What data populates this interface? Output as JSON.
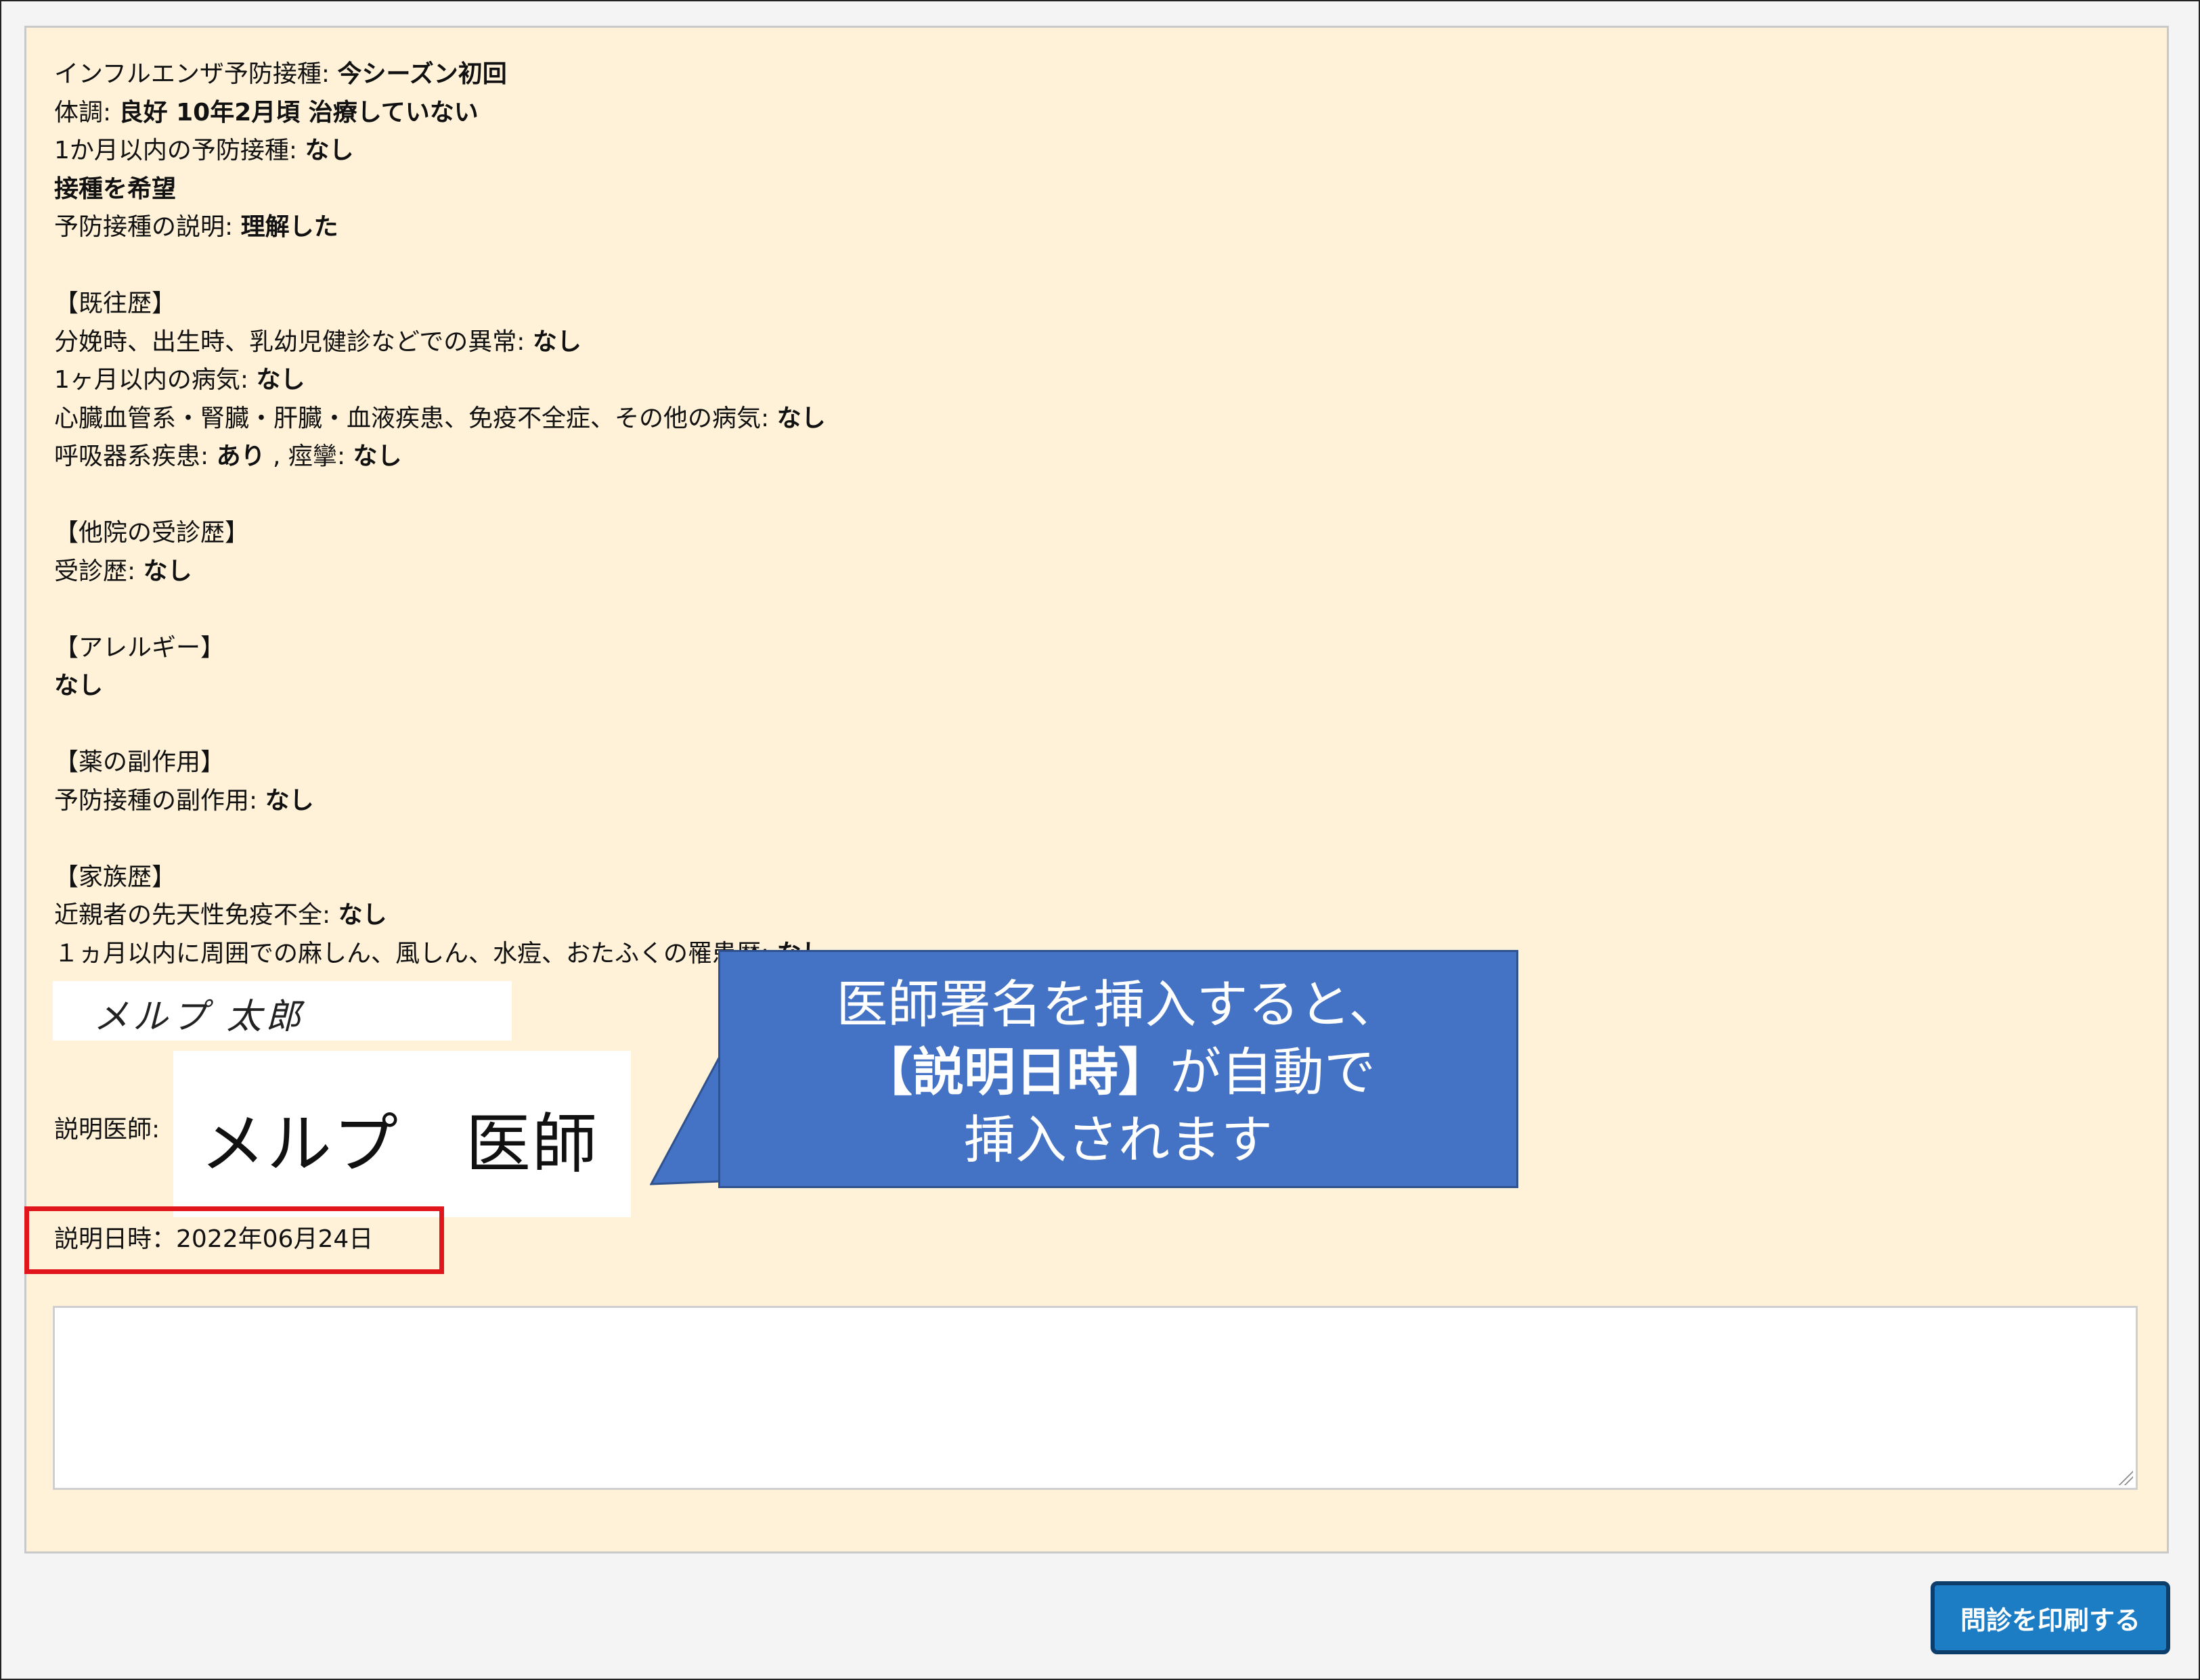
{
  "questionnaire": {
    "vaccine_label": "インフルエンザ予防接種: ",
    "vaccine_value": "今シーズン初回",
    "condition_label": "体調: ",
    "condition_value": "良好 10年2月頃 治療していない",
    "recent_vaccine_label": "1か月以内の予防接種: ",
    "recent_vaccine_value": "なし",
    "wish": "接種を希望",
    "explanation_label": "予防接種の説明: ",
    "explanation_value": "理解した",
    "history_heading": "【既往歴】",
    "birth_label": "分娩時、出生時、乳幼児健診などでの異常: ",
    "birth_value": "なし",
    "illness_label": "1ヶ月以内の病気: ",
    "illness_value": "なし",
    "chronic_label": "心臓血管系・腎臓・肝臓・血液疾患、免疫不全症、その他の病気: ",
    "chronic_value": "なし",
    "resp_label": "呼吸器系疾患: ",
    "resp_value": "あり",
    "resp_sep": " , ",
    "seizure_label": "痙攣: ",
    "seizure_value": "なし",
    "other_clinic_heading": "【他院の受診歴】",
    "visit_label": "受診歴: ",
    "visit_value": "なし",
    "allergy_heading": "【アレルギー】",
    "allergy_value": "なし",
    "side_effect_heading": "【薬の副作用】",
    "side_effect_label": "予防接種の副作用: ",
    "side_effect_value": "なし",
    "family_heading": "【家族歴】",
    "immuno_label": "近親者の先天性免疫不全: ",
    "immuno_value": "なし",
    "surround_label": "１ヵ月以内に周囲での麻しん、風しん、水痘、おたふくの罹患歴: ",
    "surround_value": "なし"
  },
  "signature_text": "メルプ 太郎",
  "doctor": {
    "label": "説明医師:",
    "name": "メルプ　医師"
  },
  "date": {
    "label": "説明日時：",
    "value": "2022年06月24日"
  },
  "callout": {
    "line1": "医師署名を挿入すると、",
    "line2_bold": "【説明日時】",
    "line2_rest": "が自動で",
    "line3": "挿入されます"
  },
  "print_button_label": "問診を印刷する",
  "colors": {
    "panel_bg": "#fff2d9",
    "callout_bg": "#4472c4",
    "highlight_border": "#e0161c",
    "button_bg": "#1c7cc4"
  }
}
